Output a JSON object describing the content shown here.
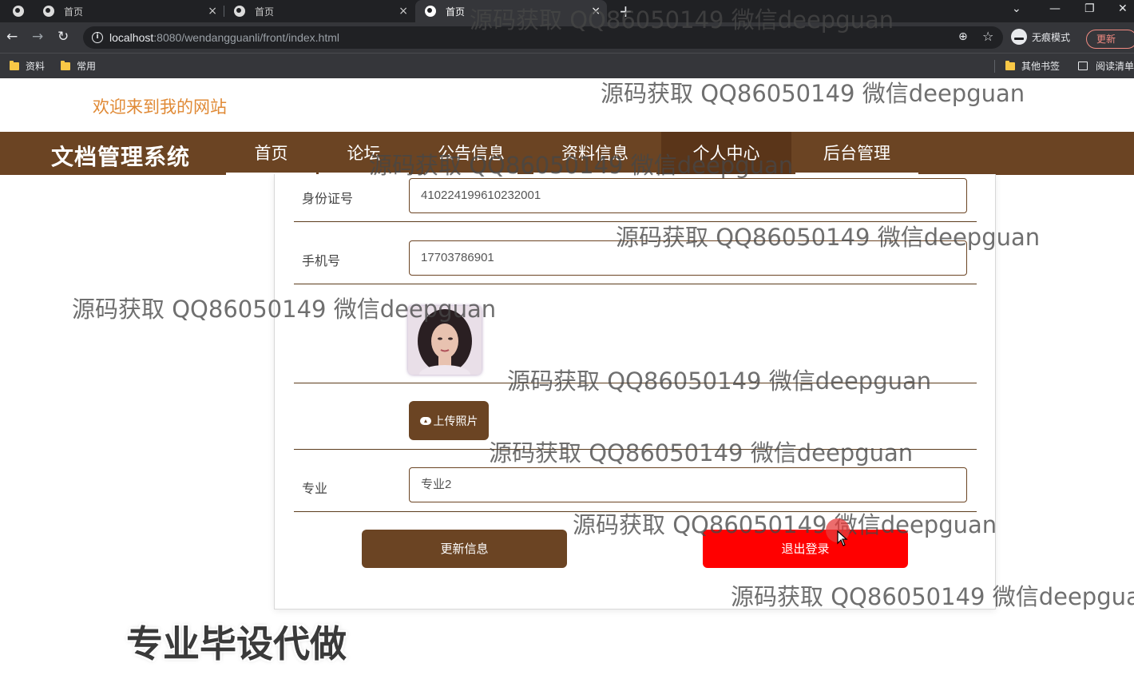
{
  "browser": {
    "tabs": [
      {
        "title": "首页",
        "close": "×"
      },
      {
        "title": "首页",
        "close": "×"
      },
      {
        "title": "首页",
        "close": "×"
      }
    ],
    "new_tab": "+",
    "url_host": "localhost",
    "url_rest": ":8080/wendangguanli/front/index.html",
    "incognito_label": "无痕模式",
    "update_label": "更新",
    "bookmarks": [
      "资料",
      "常用"
    ],
    "bookmarks_right": [
      "其他书签",
      "阅读清单"
    ]
  },
  "site": {
    "welcome": "欢迎来到我的网站",
    "brand": "文档管理系统",
    "nav": [
      "首页",
      "论坛",
      "公告信息",
      "资料信息",
      "个人中心",
      "后台管理"
    ],
    "active_nav": "个人中心"
  },
  "form": {
    "id_label": "身份证号",
    "id_value": "410224199610232001",
    "phone_label": "手机号",
    "phone_value": "17703786901",
    "upload_label": "上传照片",
    "major_label": "专业",
    "major_value": "专业2",
    "update_button": "更新信息",
    "logout_button": "退出登录"
  },
  "overlay_caption": "专业毕设代做",
  "watermark_text": "源码获取 QQ86050149 微信deepguan",
  "watermark_tail": "源码获取 QQ86050149 微信deepgua",
  "colors": {
    "nav_brown": "#6b4423",
    "logout_red": "#ff0000",
    "welcome_orange": "#e08a36"
  }
}
